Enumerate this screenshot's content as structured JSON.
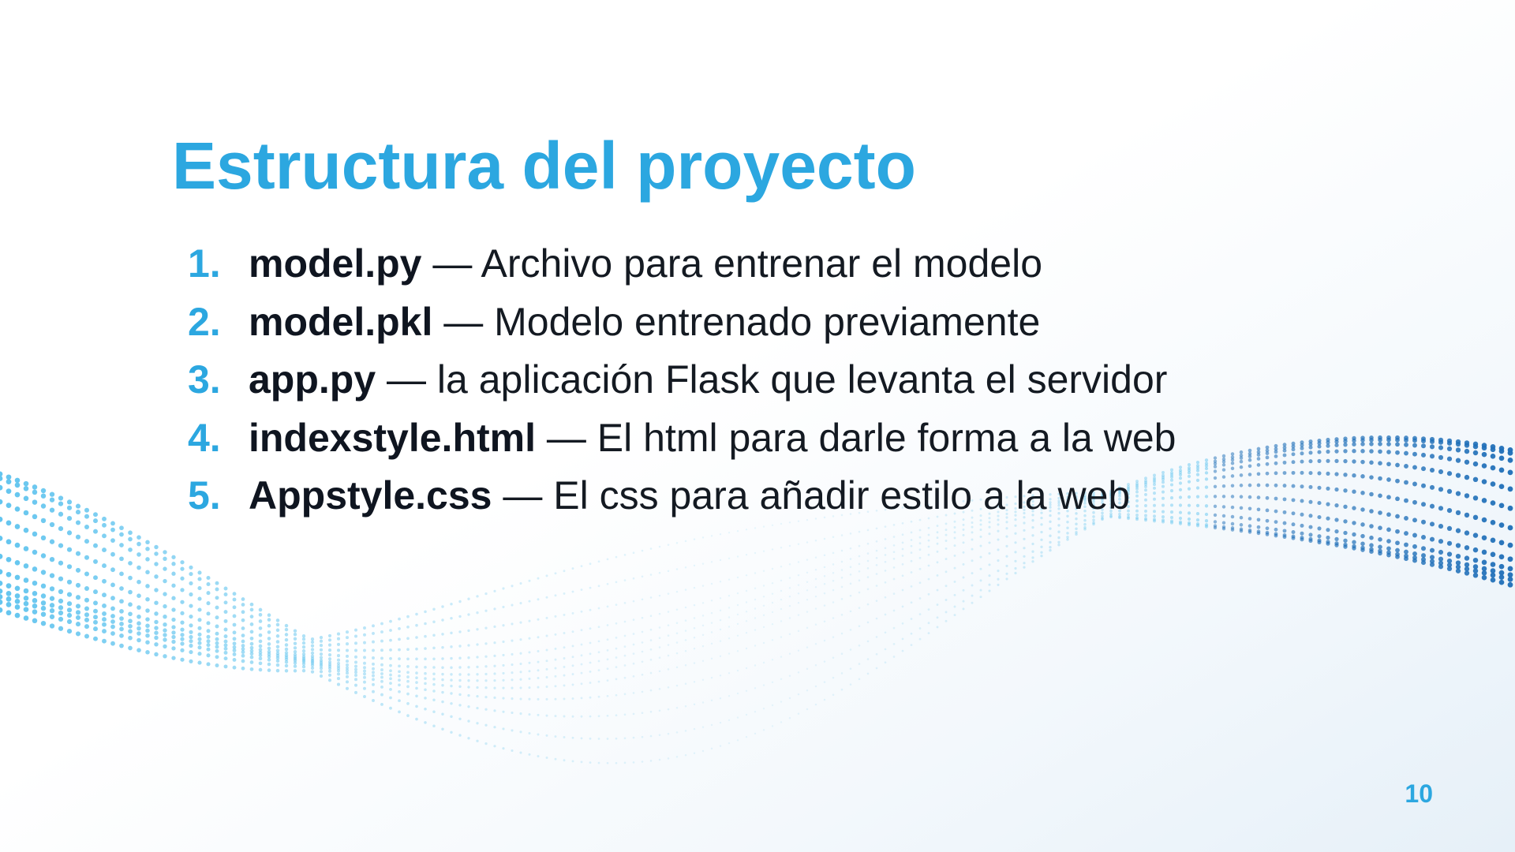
{
  "slide": {
    "title": "Estructura del proyecto",
    "items": [
      {
        "number": "1.",
        "file": "model.py",
        "description": " — Archivo para entrenar el modelo"
      },
      {
        "number": "2.",
        "file": "model.pkl",
        "description": " — Modelo entrenado previamente"
      },
      {
        "number": "3.",
        "file": "app.py",
        "description": " — la aplicación Flask que levanta el servidor"
      },
      {
        "number": "4.",
        "file": "indexstyle.html",
        "description": " — El html para darle forma a la web"
      },
      {
        "number": "5.",
        "file": "Appstyle.css",
        "description": " — El css para añadir estilo a la web"
      }
    ],
    "page_number": "10"
  },
  "colors": {
    "accent": "#2ca7e0",
    "text": "#141a22",
    "wave_dark": "#1f6fb8",
    "wave_light": "#5ec3ee"
  },
  "decoration": "dotted-wave"
}
